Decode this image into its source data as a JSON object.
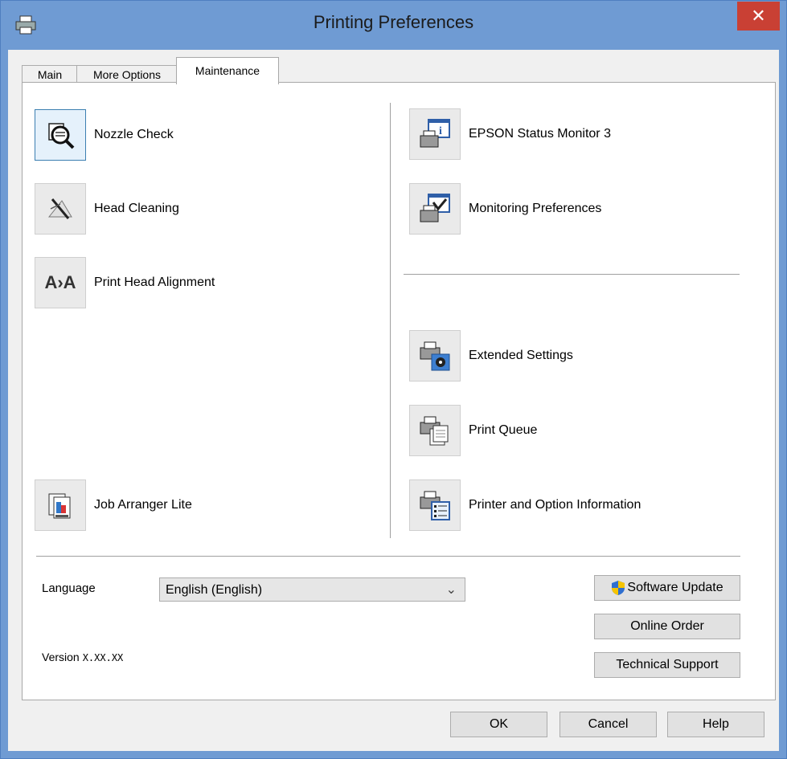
{
  "window": {
    "title": "Printing Preferences",
    "close_glyph": "✕"
  },
  "tabs": [
    {
      "label": "Main"
    },
    {
      "label": "More Options"
    },
    {
      "label": "Maintenance"
    }
  ],
  "left_tools": [
    {
      "label": "Nozzle Check",
      "icon": "nozzle-check-icon"
    },
    {
      "label": "Head Cleaning",
      "icon": "head-cleaning-icon"
    },
    {
      "label": "Print Head Alignment",
      "icon": "print-head-alignment-icon",
      "icon_text": "A›A"
    },
    {
      "label": "Job Arranger Lite",
      "icon": "job-arranger-icon"
    }
  ],
  "right_tools": [
    {
      "label": "EPSON Status Monitor 3",
      "icon": "status-monitor-icon"
    },
    {
      "label": "Monitoring Preferences",
      "icon": "monitoring-preferences-icon"
    },
    {
      "label": "Extended Settings",
      "icon": "extended-settings-icon"
    },
    {
      "label": "Print Queue",
      "icon": "print-queue-icon"
    },
    {
      "label": "Printer and Option Information",
      "icon": "printer-info-icon"
    }
  ],
  "language": {
    "label": "Language",
    "value": "English (English)",
    "arrow": "⌄"
  },
  "version": {
    "label": "Version",
    "value": "X.XX.XX"
  },
  "side_buttons": {
    "software_update": "Software Update",
    "online_order": "Online Order",
    "technical_support": "Technical Support"
  },
  "footer": {
    "ok": "OK",
    "cancel": "Cancel",
    "help": "Help"
  },
  "colors": {
    "titlebar": "#6f9bd3",
    "close": "#c94034",
    "selected_tool": "#e5f1fb"
  }
}
